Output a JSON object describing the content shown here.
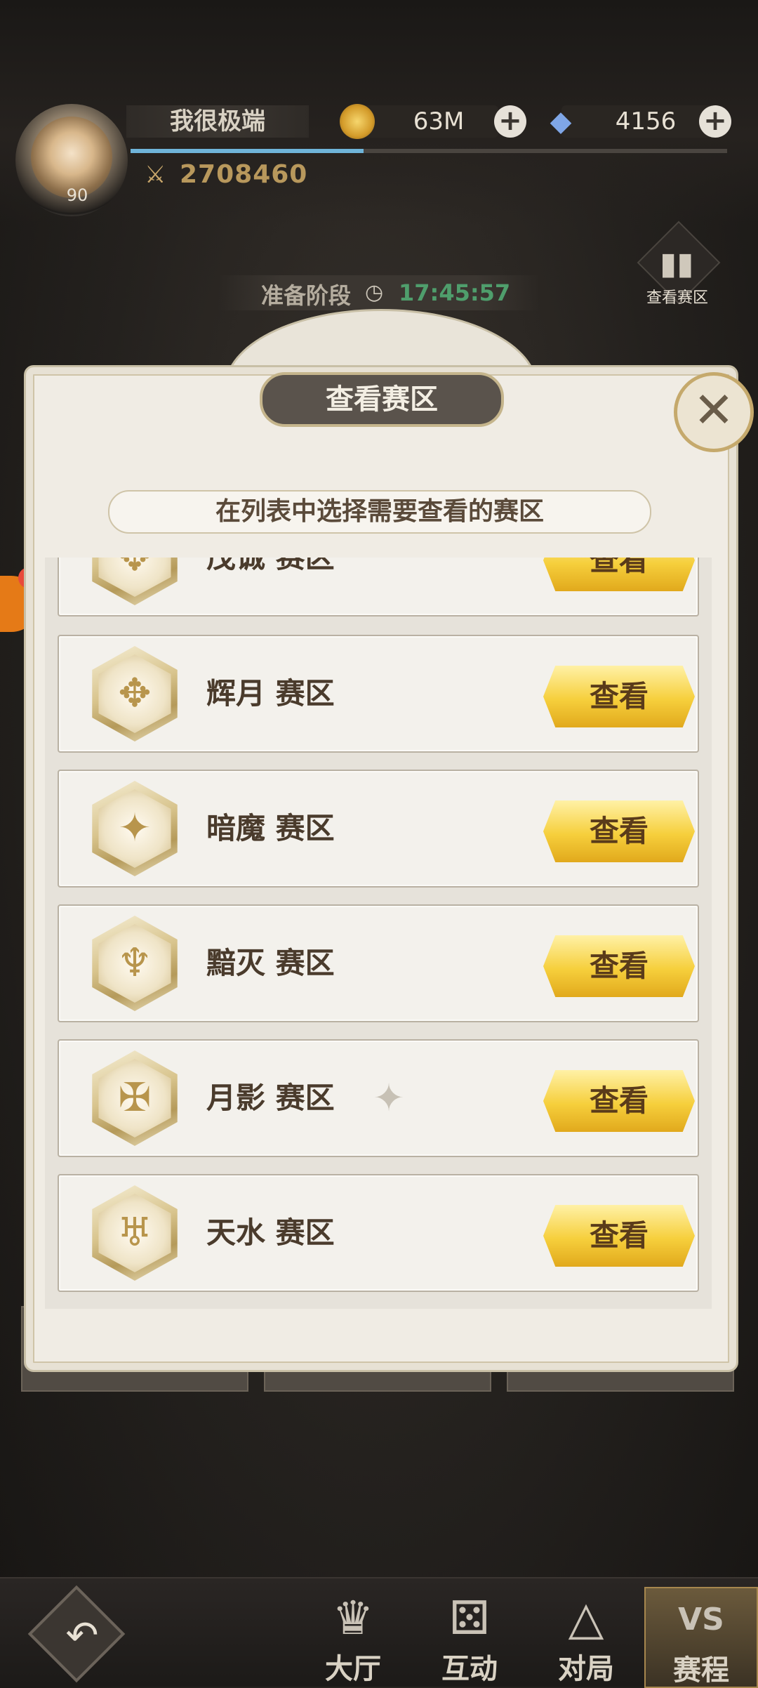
{
  "player": {
    "name": "我很极端",
    "level": "90",
    "power": "2708460",
    "xp_fraction": 0.39
  },
  "currency": {
    "gold": "63M",
    "gems": "4156"
  },
  "stage": {
    "label": "准备阶段",
    "time": "17:45:57"
  },
  "top_button": {
    "label": "查看赛区"
  },
  "dialog": {
    "title": "查看赛区",
    "subtitle": "在列表中选择需要查看的赛区",
    "view_label": "查看",
    "zones": [
      {
        "name": "茂诚 赛区",
        "icon": "crest-icon"
      },
      {
        "name": "辉月 赛区",
        "icon": "crest-icon"
      },
      {
        "name": "暗魔 赛区",
        "icon": "crest-icon"
      },
      {
        "name": "黯灭 赛区",
        "icon": "crest-icon"
      },
      {
        "name": "月影 赛区",
        "icon": "crest-icon",
        "marker": "star-icon"
      },
      {
        "name": "天水 赛区",
        "icon": "crest-icon"
      }
    ]
  },
  "nav": {
    "items": [
      {
        "label": "大厅",
        "icon": "crown-icon"
      },
      {
        "label": "互动",
        "icon": "dice-icon"
      },
      {
        "label": "对局",
        "icon": "triangle-icon"
      },
      {
        "label": "赛程",
        "icon": "vs-icon",
        "active": true
      }
    ]
  },
  "colors": {
    "accent_gold": "#f6cf3c",
    "timer_green": "#4f9e6c",
    "dialog_bg": "#f0ece4"
  }
}
